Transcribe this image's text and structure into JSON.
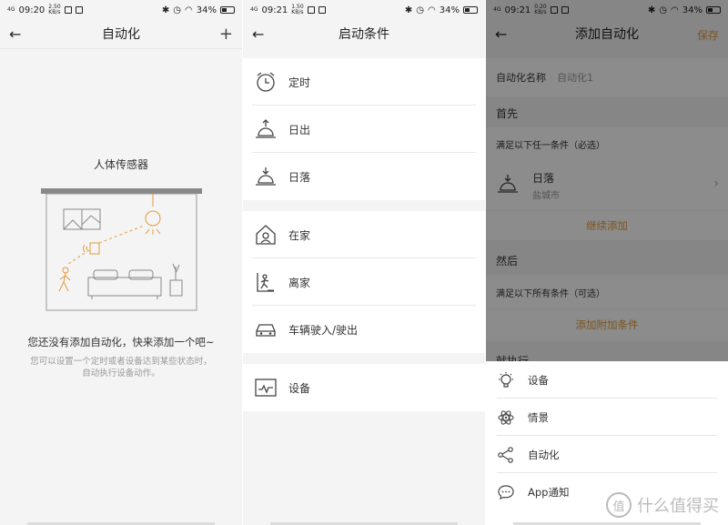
{
  "panel1": {
    "status": {
      "time": "09:20",
      "speed_top": "2.50",
      "speed_bot": "KB/s",
      "signal": "4G",
      "battery": "34%"
    },
    "header": {
      "title": "自动化",
      "back_icon": "←",
      "add_icon": "+"
    },
    "illustration_title": "人体传感器",
    "empty_main": "您还没有添加自动化，快来添加一个吧~",
    "empty_sub": "您可以设置一个定时或者设备达到某些状态时，自动执行设备动作。"
  },
  "panel2": {
    "status": {
      "time": "09:21",
      "speed_top": "1.50",
      "speed_bot": "KB/s",
      "signal": "4G",
      "battery": "34%"
    },
    "header": {
      "title": "启动条件",
      "back_icon": "←"
    },
    "groups": [
      [
        {
          "label": "定时",
          "icon": "alarm-clock-icon"
        },
        {
          "label": "日出",
          "icon": "sunrise-icon"
        },
        {
          "label": "日落",
          "icon": "sunset-icon"
        }
      ],
      [
        {
          "label": "在家",
          "icon": "home-icon"
        },
        {
          "label": "离家",
          "icon": "leave-home-icon"
        },
        {
          "label": "车辆驶入/驶出",
          "icon": "car-icon"
        }
      ],
      [
        {
          "label": "设备",
          "icon": "device-icon"
        }
      ]
    ]
  },
  "panel3": {
    "status": {
      "time": "09:21",
      "speed_top": "0.20",
      "speed_bot": "KB/s",
      "signal": "4G",
      "battery": "34%"
    },
    "header": {
      "title": "添加自动化",
      "back_icon": "←",
      "save": "保存"
    },
    "name_label": "自动化名称",
    "name_value": "自动化1",
    "first_label": "首先",
    "first_hint": "满足以下任一条件（必选）",
    "condition": {
      "title": "日落",
      "subtitle": "盐城市"
    },
    "continue_add": "继续添加",
    "then_label": "然后",
    "then_hint": "满足以下所有条件（可选）",
    "add_extra": "添加附加条件",
    "do_label": "就执行",
    "sheet": [
      {
        "label": "设备",
        "icon": "bulb-icon"
      },
      {
        "label": "情景",
        "icon": "atom-icon"
      },
      {
        "label": "自动化",
        "icon": "share-nodes-icon"
      },
      {
        "label": "App通知",
        "icon": "chat-bubble-icon"
      }
    ]
  },
  "watermark": {
    "icon": "值",
    "text": "什么值得买"
  },
  "colors": {
    "accent": "#e29b3c",
    "line_orange": "#f0a23c",
    "bg": "#f4f4f4"
  }
}
